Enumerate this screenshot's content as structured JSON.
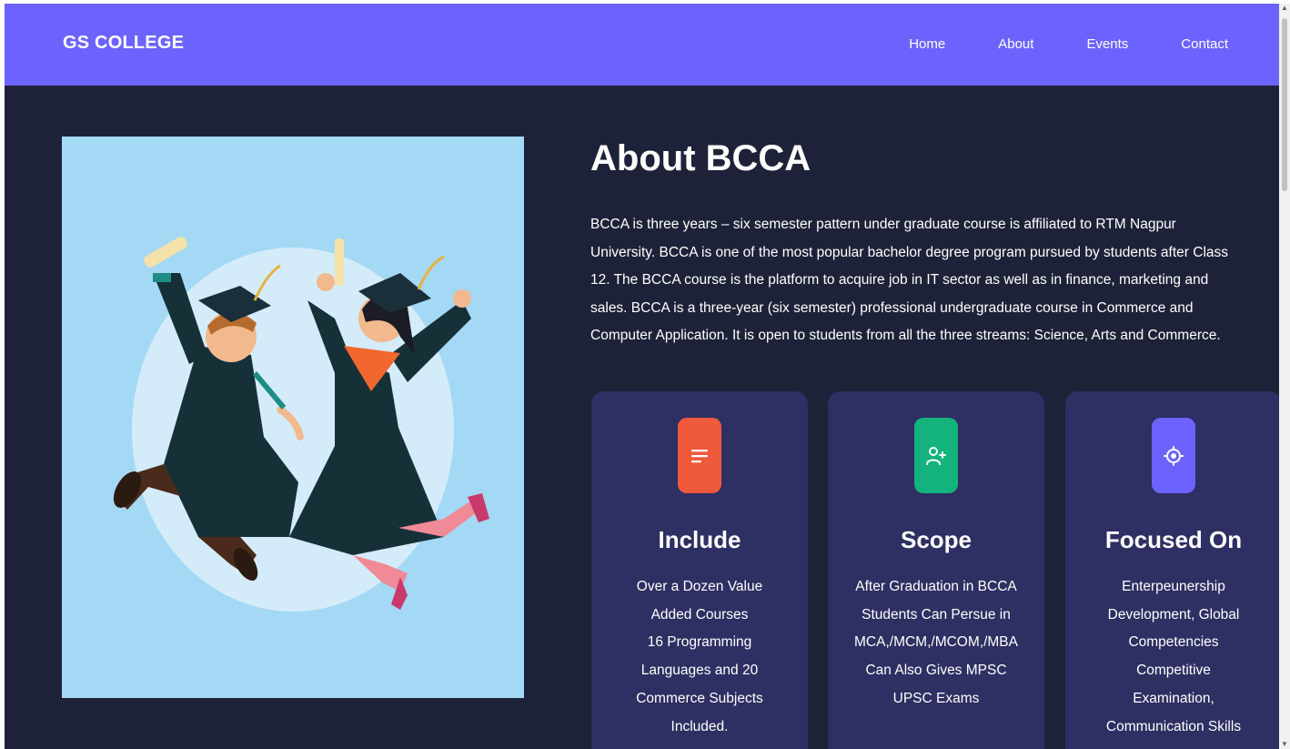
{
  "navbar": {
    "brand": "GS COLLEGE",
    "links": [
      "Home",
      "About",
      "Events",
      "Contact"
    ],
    "color": "#6c63ff"
  },
  "hero_image": {
    "description_icon": "graduates-illustration",
    "background": "#a4d9f5"
  },
  "about": {
    "title": "About BCCA",
    "lines": [
      "BCCA is three years – six semester pattern under graduate course is affiliated to RTM Nagpur",
      "University. BCCA is one of the most popular bachelor degree program pursued by students after Class",
      "12. The BCCA course is the platform to acquire job in IT sector as well as in finance, marketing and",
      "sales. BCCA is a three-year (six semester) professional undergraduate course in Commerce and",
      "Computer Application. It is open to students from all the three streams: Science, Arts and Commerce."
    ]
  },
  "cards": [
    {
      "title": "Include",
      "icon": "list-icon",
      "icon_color": "#ef5a3c",
      "lines": [
        "Over a Dozen Value",
        "Added Courses",
        "16 Programming",
        "Languages and 20",
        "Commerce Subjects",
        "Included."
      ]
    },
    {
      "title": "Scope",
      "icon": "user-add-icon",
      "icon_color": "#14b37d",
      "lines": [
        "After Graduation in BCCA",
        "Students Can Persue in",
        "MCA,/MCM,/MCOM,/MBA",
        "Can Also Gives MPSC",
        "UPSC Exams"
      ]
    },
    {
      "title": "Focused On",
      "icon": "target-icon",
      "icon_color": "#6c63ff",
      "lines": [
        "Enterpeunership",
        "Development, Global",
        "Competencies",
        "Competitive",
        "Examination,",
        "Communication Skills"
      ]
    }
  ],
  "colors": {
    "page_background": "#1d2238",
    "card_background": "#2e2f62"
  }
}
